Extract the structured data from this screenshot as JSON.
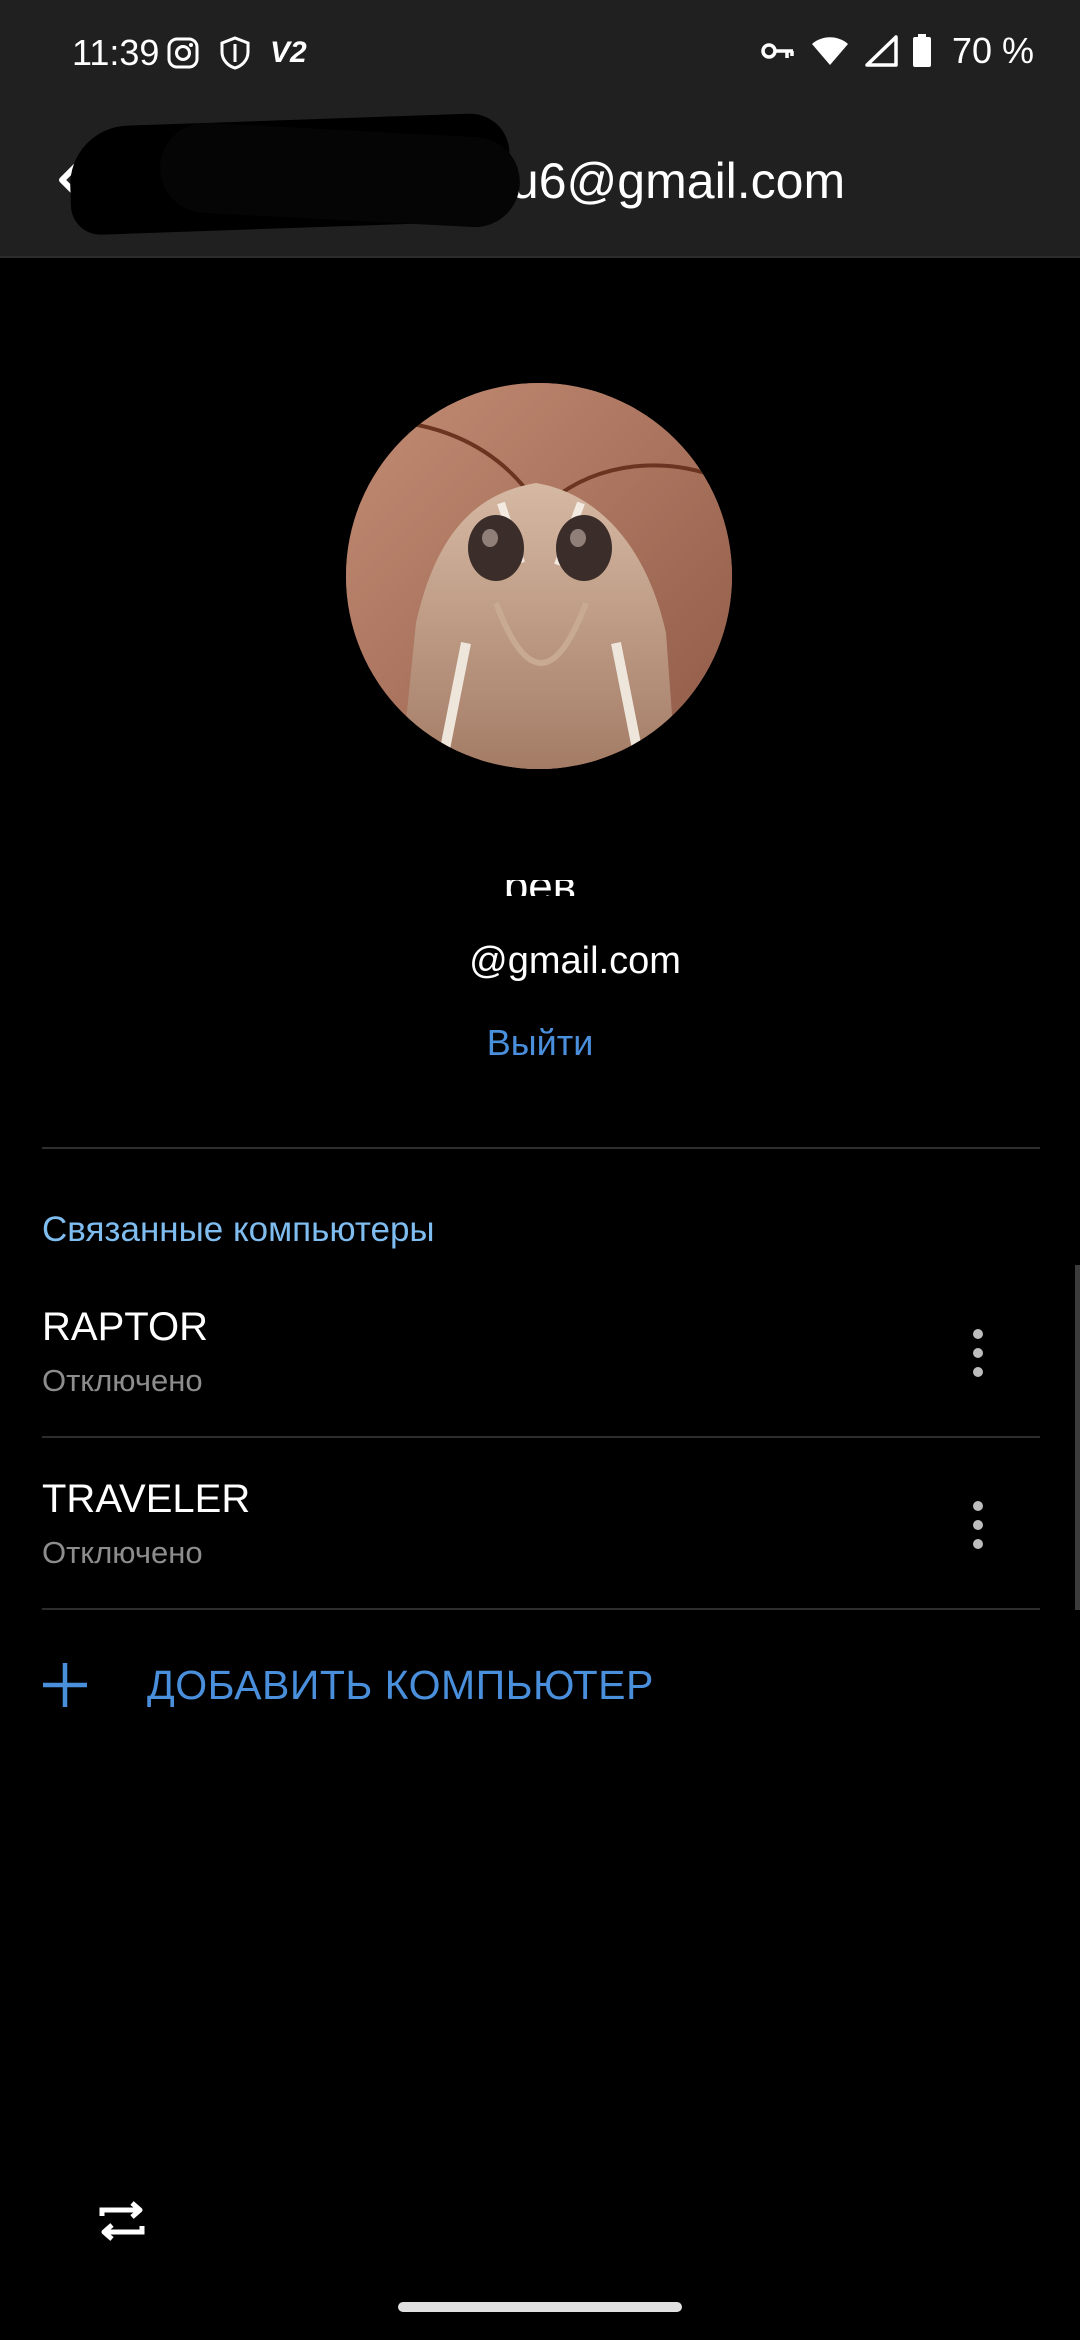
{
  "status_bar": {
    "time": "11:39",
    "left_icons": [
      "instagram-icon",
      "shield-icon",
      "v2-icon"
    ],
    "v2_label": "V2",
    "right_icons": [
      "vpn-key-icon",
      "wifi-icon",
      "signal-icon",
      "battery-icon"
    ],
    "battery": "70 %"
  },
  "app_bar": {
    "title": "                  sub6@gmail.com",
    "title_visible": "зu6@gmail.com"
  },
  "profile": {
    "name_partial": "рев",
    "email": "@gmail.com",
    "sign_out": "Выйти"
  },
  "linked": {
    "title": "Связанные компьютеры",
    "computers": [
      {
        "name": "RAPTOR",
        "status": "Отключено"
      },
      {
        "name": "TRAVELER",
        "status": "Отключено"
      }
    ],
    "add_label": "ДОБАВИТЬ КОМПЬЮТЕР"
  },
  "colors": {
    "accent": "#4a8fdc",
    "section": "#7fbdf0",
    "bar": "#202020",
    "background": "#000000"
  }
}
